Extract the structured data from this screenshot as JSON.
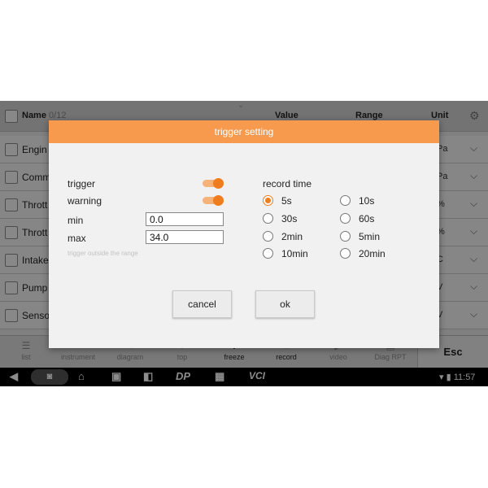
{
  "table": {
    "header": {
      "name": "Name",
      "count": "0/12",
      "value": "Value",
      "range": "Range",
      "unit": "Unit"
    },
    "rows": [
      {
        "name": "Engin",
        "unit": "Pa"
      },
      {
        "name": "Comm",
        "unit": "Pa"
      },
      {
        "name": "Thrott",
        "unit": "%"
      },
      {
        "name": "Thrott",
        "unit": "%"
      },
      {
        "name": "Intake",
        "unit": "C"
      },
      {
        "name": "Pump",
        "unit": "V"
      },
      {
        "name": "Senso",
        "unit": "V"
      }
    ]
  },
  "toolbar": {
    "items": [
      {
        "label": "list",
        "icon": "list-icon"
      },
      {
        "label": "instrument",
        "icon": "gauge-icon"
      },
      {
        "label": "diagram",
        "icon": "diagram-icon"
      },
      {
        "label": "top",
        "icon": "top-icon"
      },
      {
        "label": "freeze",
        "icon": "freeze-icon"
      },
      {
        "label": "record",
        "icon": "record-icon"
      },
      {
        "label": "video",
        "icon": "video-icon"
      },
      {
        "label": "Diag RPT",
        "icon": "report-icon"
      }
    ],
    "esc": "Esc"
  },
  "navbar": {
    "dp": "DP",
    "vci": "VCI",
    "time": "11:57"
  },
  "dialog": {
    "title": "trigger setting",
    "trigger_label": "trigger",
    "trigger_on": true,
    "warning_label": "warning",
    "warning_on": true,
    "min_label": "min",
    "min_value": "0.0",
    "max_label": "max",
    "max_value": "34.0",
    "hint": "trigger outside the range",
    "record_time_label": "record time",
    "record_options": [
      "5s",
      "10s",
      "30s",
      "60s",
      "2min",
      "5min",
      "10min",
      "20min"
    ],
    "selected_record": "5s",
    "cancel": "cancel",
    "ok": "ok"
  },
  "colors": {
    "accent": "#f07d1d",
    "title_bar": "#f79a4e"
  }
}
